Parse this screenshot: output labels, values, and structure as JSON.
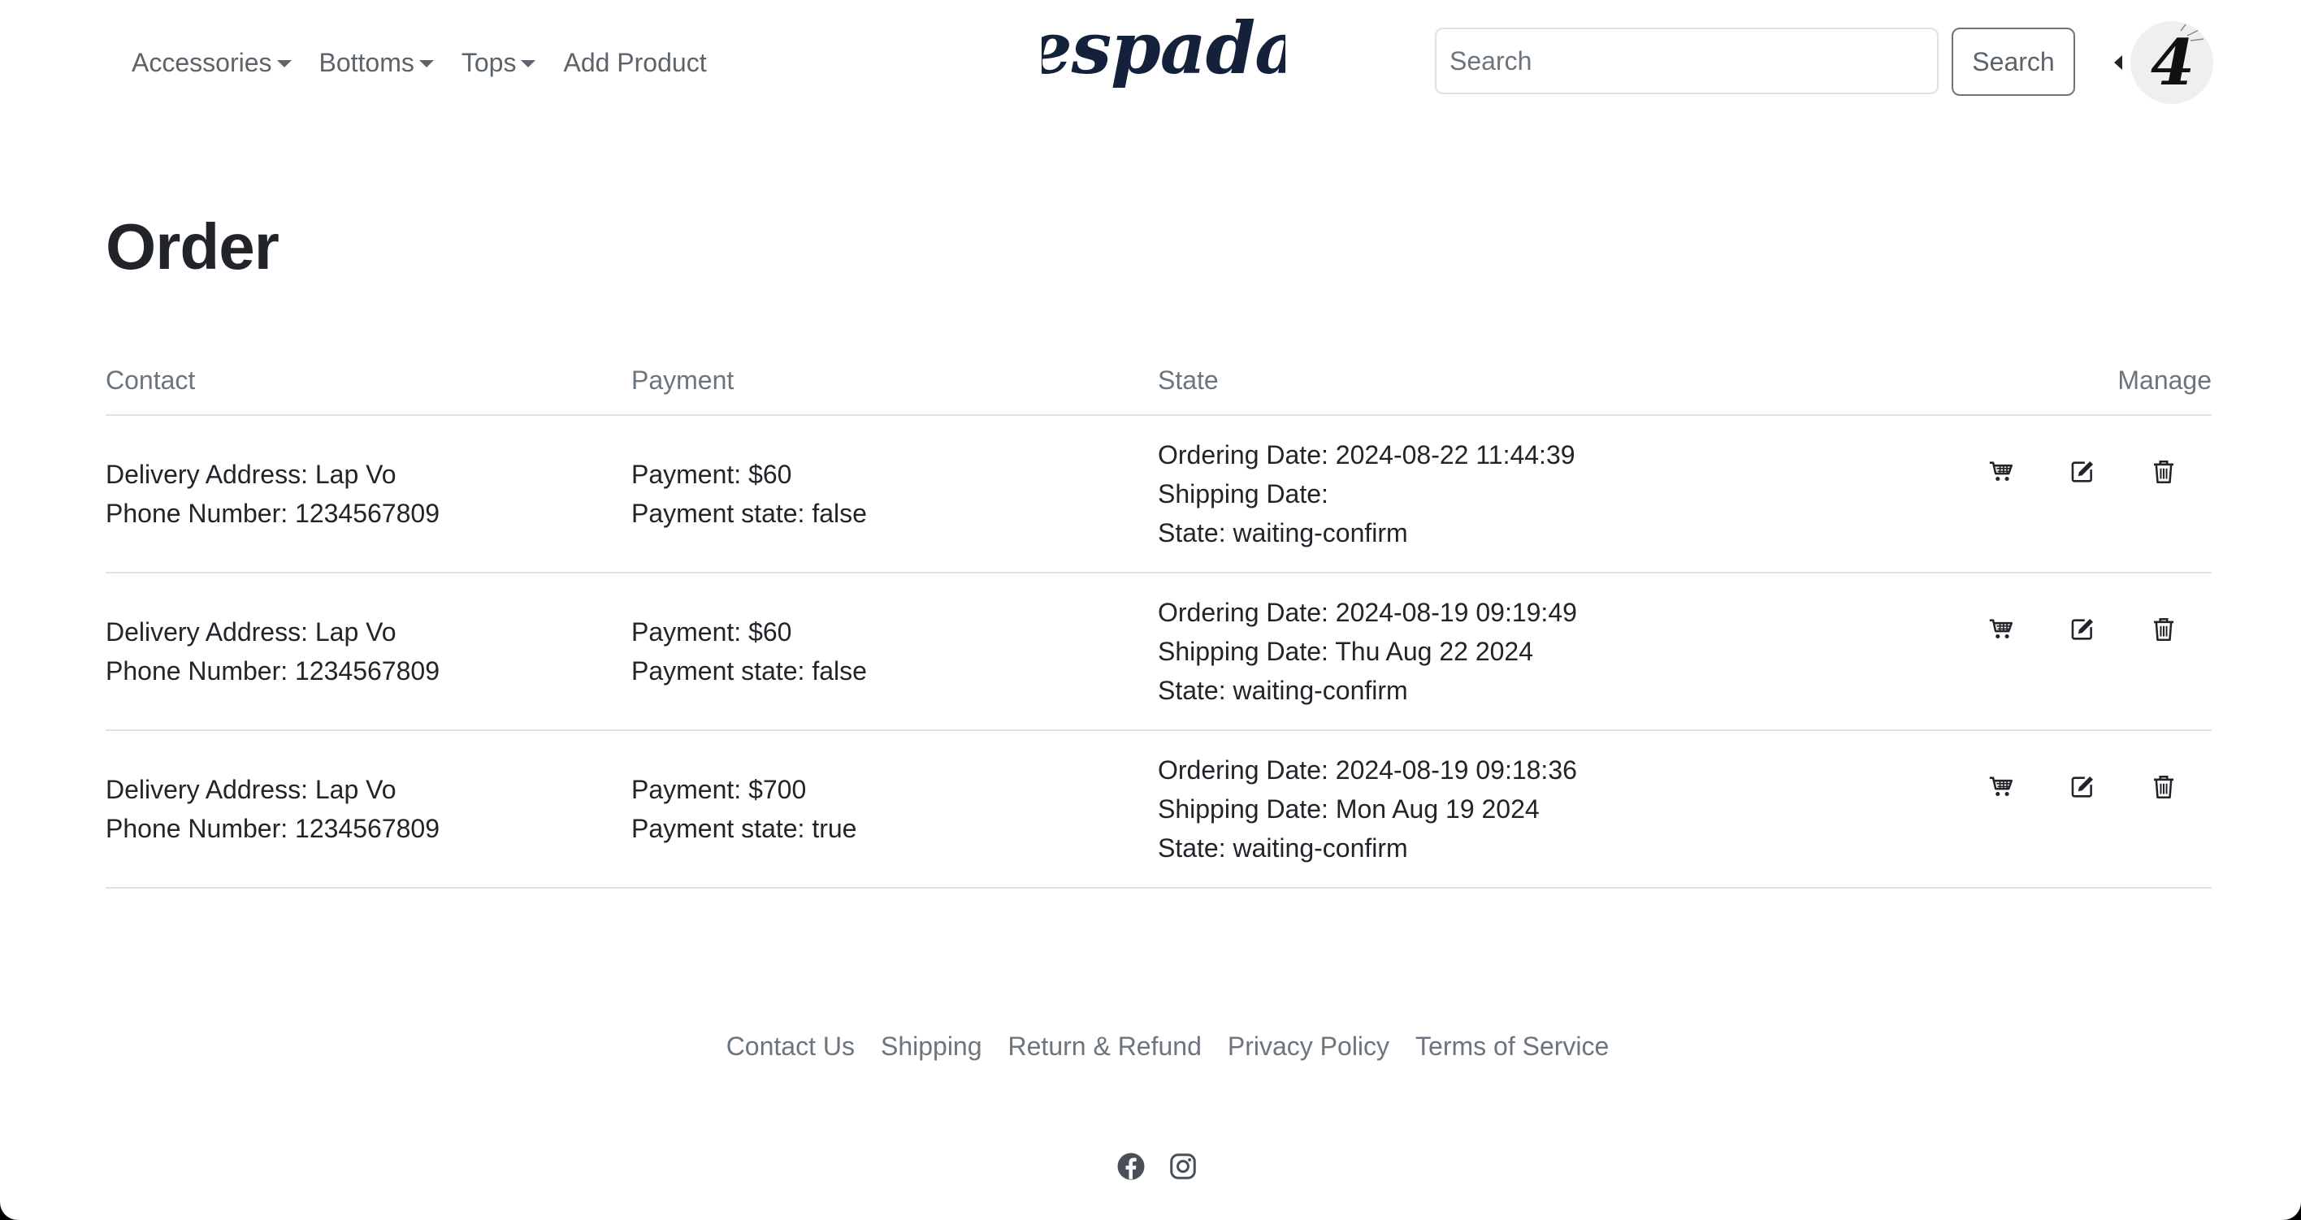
{
  "navbar": {
    "menu": [
      {
        "label": "Accessories",
        "has_dropdown": true
      },
      {
        "label": "Bottoms",
        "has_dropdown": true
      },
      {
        "label": "Tops",
        "has_dropdown": true
      },
      {
        "label": "Add Product",
        "has_dropdown": false
      }
    ],
    "brand": "espada",
    "search": {
      "placeholder": "Search",
      "value": "",
      "button_label": "Search"
    },
    "user_avatar_text": "4"
  },
  "page_title": "Order",
  "orders_table": {
    "headers": {
      "contact": "Contact",
      "payment": "Payment",
      "state": "State",
      "manage": "Manage"
    },
    "rows": [
      {
        "delivery_address": "Delivery Address: Lap Vo",
        "phone_number": "Phone Number: 1234567809",
        "payment": "Payment: $60",
        "payment_state": "Payment state: false",
        "ordering_date": "Ordering Date: 2024-08-22 11:44:39",
        "shipping_date": "Shipping Date:",
        "state": "State: waiting-confirm"
      },
      {
        "delivery_address": "Delivery Address: Lap Vo",
        "phone_number": "Phone Number: 1234567809",
        "payment": "Payment: $60",
        "payment_state": "Payment state: false",
        "ordering_date": "Ordering Date: 2024-08-19 09:19:49",
        "shipping_date": "Shipping Date: Thu Aug 22 2024",
        "state": "State: waiting-confirm"
      },
      {
        "delivery_address": "Delivery Address: Lap Vo",
        "phone_number": "Phone Number: 1234567809",
        "payment": "Payment: $700",
        "payment_state": "Payment state: true",
        "ordering_date": "Ordering Date: 2024-08-19 09:18:36",
        "shipping_date": "Shipping Date: Mon Aug 19 2024",
        "state": "State: waiting-confirm"
      }
    ],
    "manage_icons": [
      "cart-icon",
      "edit-icon",
      "trash-icon"
    ]
  },
  "footer": {
    "links": [
      "Contact Us",
      "Shipping",
      "Return & Refund",
      "Privacy Policy",
      "Terms of Service"
    ],
    "social_icons": [
      "facebook-icon",
      "instagram-icon"
    ]
  },
  "colors": {
    "brand": "#14213a",
    "text": "#212529",
    "muted": "#6c757d",
    "border": "#dee2e6"
  }
}
